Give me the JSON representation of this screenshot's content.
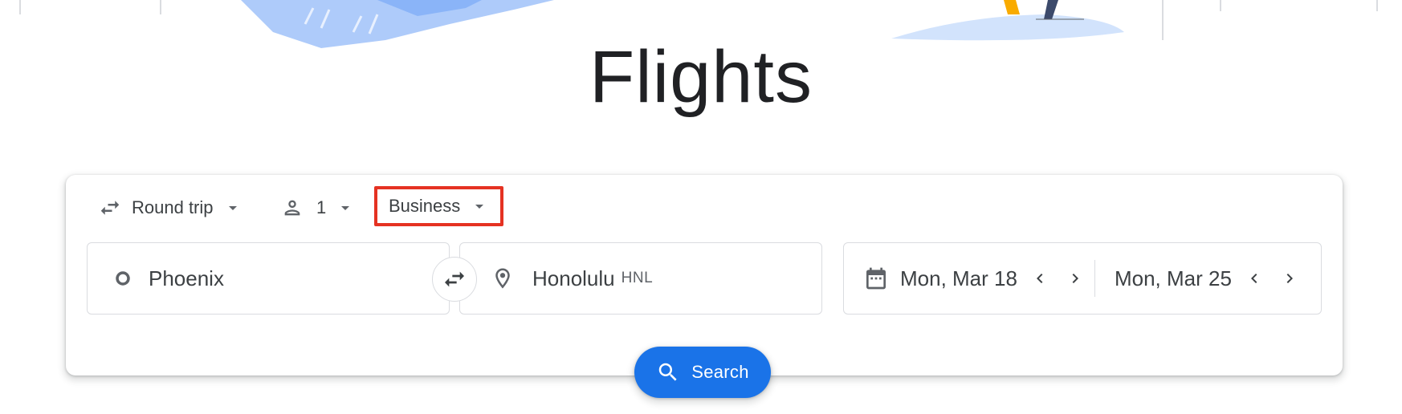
{
  "page": {
    "title": "Flights"
  },
  "search_form": {
    "trip_type": {
      "label": "Round trip",
      "icon": "swap-horiz-icon"
    },
    "passengers": {
      "value": "1",
      "icon": "person-icon"
    },
    "cabin_class": {
      "label": "Business",
      "highlight_color": "#e53222"
    },
    "origin": {
      "value": "Phoenix",
      "icon": "circle-outline-icon"
    },
    "swap_icon": "swap-arrows-icon",
    "destination": {
      "value": "Honolulu",
      "code": "HNL",
      "icon": "location-pin-icon"
    },
    "dates": {
      "icon": "calendar-icon",
      "departure": "Mon, Mar 18",
      "return": "Mon, Mar 25"
    },
    "search_button": {
      "label": "Search",
      "icon": "search-icon",
      "color": "#1a73e8"
    }
  }
}
